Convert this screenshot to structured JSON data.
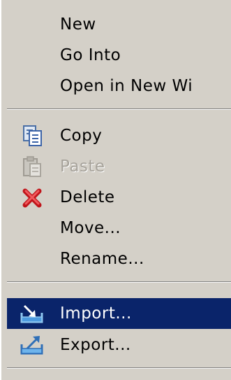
{
  "menu": {
    "items": [
      {
        "label": "New",
        "icon": null,
        "disabled": false
      },
      {
        "label": "Go Into",
        "icon": null,
        "disabled": false
      },
      {
        "label": "Open in New Wi",
        "icon": null,
        "disabled": false
      },
      {
        "label": "Copy",
        "icon": "copy-icon",
        "disabled": false
      },
      {
        "label": "Paste",
        "icon": "paste-icon",
        "disabled": true
      },
      {
        "label": "Delete",
        "icon": "delete-icon",
        "disabled": false
      },
      {
        "label": "Move...",
        "icon": null,
        "disabled": false
      },
      {
        "label": "Rename...",
        "icon": null,
        "disabled": false
      },
      {
        "label": "Import...",
        "icon": "import-icon",
        "disabled": false,
        "highlighted": true
      },
      {
        "label": "Export...",
        "icon": "export-icon",
        "disabled": false
      }
    ]
  },
  "colors": {
    "menu_background": "#d4d0c8",
    "highlight_background": "#0a246a",
    "highlight_text": "#ffffff",
    "disabled_text": "#a6a29a"
  }
}
